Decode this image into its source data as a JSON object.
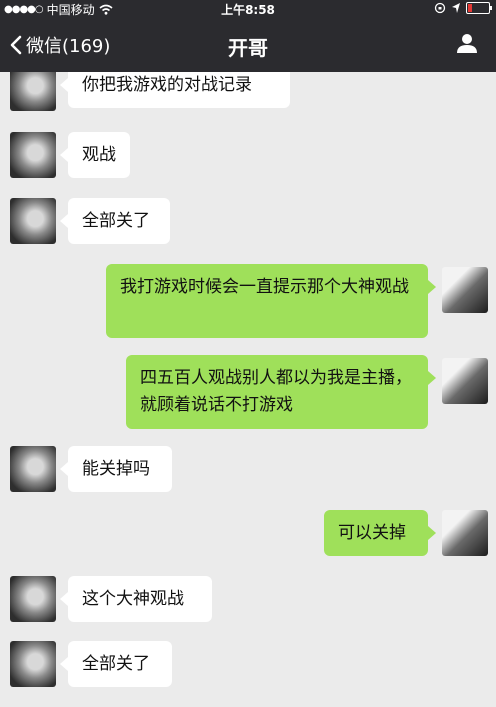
{
  "status_bar": {
    "carrier": "中国移动",
    "time": "上午8:58"
  },
  "nav": {
    "back_label": "微信(169)",
    "title": "开哥"
  },
  "messages": [
    {
      "side": "in",
      "text": "你把我游戏的对战记录"
    },
    {
      "side": "in",
      "text": "观战"
    },
    {
      "side": "in",
      "text": "全部关了"
    },
    {
      "side": "out",
      "text": "我打游戏时候会一直提示那个大神观战"
    },
    {
      "side": "out",
      "text": "四五百人观战别人都以为我是主播，就顾着说话不打游戏"
    },
    {
      "side": "in",
      "text": "能关掉吗"
    },
    {
      "side": "out",
      "text": "可以关掉"
    },
    {
      "side": "in",
      "text": "这个大神观战"
    },
    {
      "side": "in",
      "text": "全部关了"
    }
  ]
}
